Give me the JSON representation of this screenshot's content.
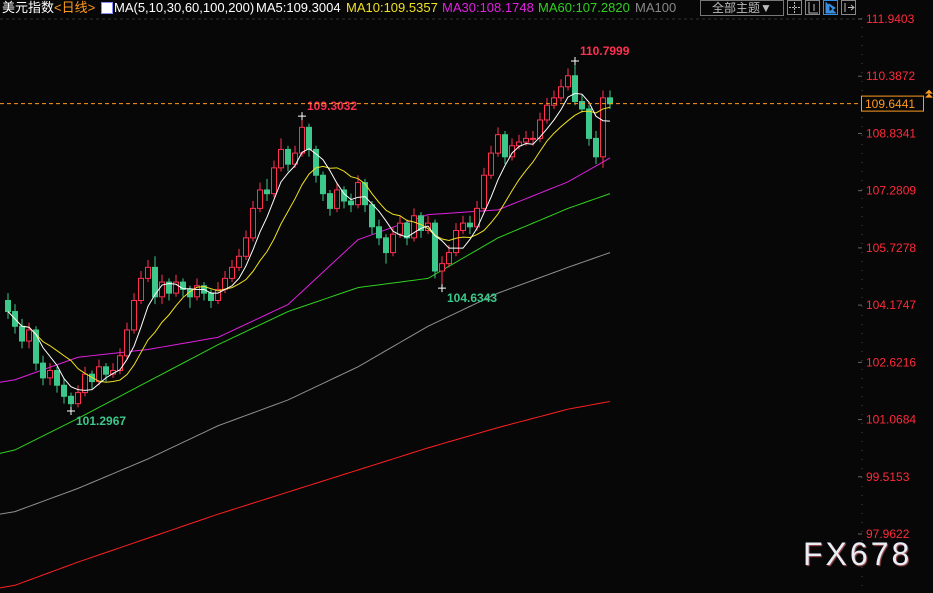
{
  "header": {
    "title": "美元指数",
    "period": "<日线>",
    "ma_spec": "MA(5,10,30,60,100,200)",
    "ma5": "MA5:109.3004",
    "ma10": "MA10:109.5357",
    "ma30": "MA30:108.1748",
    "ma60": "MA60:107.2820",
    "ma100": "MA100",
    "theme_button": "全部主题▼",
    "icons": [
      "crosshair-icon",
      "axis-icon",
      "play-icon",
      "exit-icon"
    ]
  },
  "watermark": "FX678",
  "colors": {
    "up": "#ff3050",
    "down": "#3cc88a",
    "ma5": "#ffffff",
    "ma10": "#f0e020",
    "ma30": "#e020e0",
    "ma60": "#30d020",
    "ma100": "#909090",
    "ma200": "#ff2020",
    "last": "#ff9a20"
  },
  "chart_data": {
    "type": "candlestick",
    "title": "美元指数 日线",
    "y_ticks": [
      "111.9403",
      "110.3872",
      "108.8341",
      "107.2809",
      "105.7278",
      "104.1747",
      "102.6216",
      "101.0684",
      "99.5153",
      "97.9622"
    ],
    "ylim": [
      97.9622,
      111.9403
    ],
    "last_price": "109.6441",
    "annotations": [
      {
        "text": "109.3032",
        "index": 42,
        "type": "high"
      },
      {
        "text": "110.7999",
        "index": 81,
        "type": "high"
      },
      {
        "text": "104.6343",
        "index": 62,
        "type": "low"
      },
      {
        "text": "101.2967",
        "index": 9,
        "type": "low"
      }
    ],
    "ohlc": [
      [
        104.3,
        104.5,
        103.8,
        104.0
      ],
      [
        104.0,
        104.2,
        103.4,
        103.6
      ],
      [
        103.6,
        103.8,
        103.0,
        103.2
      ],
      [
        103.2,
        103.7,
        103.0,
        103.5
      ],
      [
        103.5,
        103.6,
        102.4,
        102.6
      ],
      [
        102.6,
        102.8,
        102.0,
        102.2
      ],
      [
        102.2,
        102.6,
        102.0,
        102.4
      ],
      [
        102.4,
        102.5,
        101.8,
        102.0
      ],
      [
        102.0,
        102.2,
        101.5,
        101.7
      ],
      [
        101.7,
        101.8,
        101.3,
        101.5
      ],
      [
        101.5,
        102.0,
        101.4,
        101.8
      ],
      [
        101.8,
        102.5,
        101.7,
        102.3
      ],
      [
        102.3,
        102.4,
        101.9,
        102.1
      ],
      [
        102.1,
        102.7,
        102.0,
        102.5
      ],
      [
        102.5,
        102.6,
        102.1,
        102.3
      ],
      [
        102.3,
        102.6,
        102.2,
        102.4
      ],
      [
        102.4,
        103.0,
        102.3,
        102.8
      ],
      [
        102.8,
        103.7,
        102.7,
        103.5
      ],
      [
        103.5,
        104.5,
        103.4,
        104.3
      ],
      [
        104.3,
        105.1,
        104.2,
        104.9
      ],
      [
        104.9,
        105.4,
        104.8,
        105.2
      ],
      [
        105.2,
        105.5,
        104.2,
        104.4
      ],
      [
        104.4,
        105.0,
        104.2,
        104.8
      ],
      [
        104.8,
        104.9,
        104.3,
        104.5
      ],
      [
        104.5,
        105.0,
        104.4,
        104.8
      ],
      [
        104.8,
        104.9,
        104.4,
        104.6
      ],
      [
        104.6,
        104.7,
        104.1,
        104.4
      ],
      [
        104.4,
        104.9,
        104.3,
        104.7
      ],
      [
        104.7,
        104.8,
        104.3,
        104.5
      ],
      [
        104.5,
        104.6,
        104.1,
        104.3
      ],
      [
        104.3,
        104.8,
        104.2,
        104.6
      ],
      [
        104.6,
        105.1,
        104.5,
        104.9
      ],
      [
        104.9,
        105.4,
        104.8,
        105.2
      ],
      [
        105.2,
        105.7,
        105.1,
        105.5
      ],
      [
        105.5,
        106.2,
        105.4,
        106.0
      ],
      [
        106.0,
        107.0,
        105.9,
        106.8
      ],
      [
        106.8,
        107.5,
        106.7,
        107.3
      ],
      [
        107.3,
        107.6,
        107.0,
        107.2
      ],
      [
        107.2,
        108.1,
        107.1,
        107.9
      ],
      [
        107.9,
        108.7,
        107.8,
        108.4
      ],
      [
        108.4,
        108.5,
        107.8,
        108.0
      ],
      [
        108.0,
        108.5,
        107.9,
        108.3
      ],
      [
        108.3,
        109.3032,
        108.2,
        109.0
      ],
      [
        109.0,
        109.1,
        108.2,
        108.4
      ],
      [
        108.4,
        108.5,
        107.5,
        107.7
      ],
      [
        107.7,
        107.8,
        107.0,
        107.2
      ],
      [
        107.2,
        107.3,
        106.6,
        106.8
      ],
      [
        106.8,
        107.5,
        106.7,
        107.3
      ],
      [
        107.3,
        107.4,
        106.8,
        107.0
      ],
      [
        107.0,
        107.2,
        106.7,
        106.9
      ],
      [
        106.9,
        107.7,
        106.8,
        107.5
      ],
      [
        107.5,
        107.6,
        106.7,
        106.9
      ],
      [
        106.9,
        107.0,
        106.1,
        106.3
      ],
      [
        106.3,
        106.5,
        105.8,
        106.0
      ],
      [
        106.0,
        106.1,
        105.3,
        105.6
      ],
      [
        105.6,
        106.3,
        105.5,
        106.1
      ],
      [
        106.1,
        106.6,
        106.0,
        106.4
      ],
      [
        106.4,
        106.5,
        105.8,
        106.0
      ],
      [
        106.0,
        106.8,
        105.9,
        106.6
      ],
      [
        106.6,
        106.7,
        106.0,
        106.2
      ],
      [
        106.2,
        106.6,
        106.1,
        106.4
      ],
      [
        106.4,
        106.5,
        104.9,
        105.1
      ],
      [
        105.1,
        105.5,
        104.6343,
        105.3
      ],
      [
        105.3,
        105.8,
        105.2,
        105.6
      ],
      [
        105.6,
        106.4,
        105.5,
        106.2
      ],
      [
        106.2,
        106.6,
        106.1,
        106.4
      ],
      [
        106.4,
        106.6,
        106.1,
        106.3
      ],
      [
        106.3,
        107.0,
        106.2,
        106.8
      ],
      [
        106.8,
        107.9,
        106.7,
        107.7
      ],
      [
        107.7,
        108.5,
        107.6,
        108.3
      ],
      [
        108.3,
        109.0,
        108.2,
        108.8
      ],
      [
        108.8,
        108.9,
        108.0,
        108.2
      ],
      [
        108.2,
        108.7,
        108.1,
        108.5
      ],
      [
        108.5,
        108.8,
        108.4,
        108.6
      ],
      [
        108.6,
        108.9,
        108.5,
        108.7
      ],
      [
        108.7,
        108.9,
        108.5,
        108.7
      ],
      [
        108.7,
        109.4,
        108.6,
        109.2
      ],
      [
        109.2,
        109.8,
        109.1,
        109.6
      ],
      [
        109.6,
        110.0,
        109.5,
        109.8
      ],
      [
        109.8,
        110.3,
        109.7,
        110.1
      ],
      [
        110.1,
        110.6,
        110.0,
        110.4
      ],
      [
        110.4,
        110.7999,
        109.6,
        109.7
      ],
      [
        109.7,
        109.9,
        109.4,
        109.5
      ],
      [
        109.5,
        109.6,
        108.5,
        108.7
      ],
      [
        108.7,
        108.9,
        108.0,
        108.2
      ],
      [
        108.2,
        110.0,
        107.9,
        109.8
      ],
      [
        109.8,
        110.0,
        109.5,
        109.64
      ]
    ],
    "ma_samples_index": [
      0,
      10,
      20,
      30,
      40,
      50,
      60,
      70,
      80,
      86
    ],
    "ma30": [
      102.08,
      102.76,
      102.97,
      103.3,
      104.19,
      105.95,
      106.63,
      106.76,
      107.52,
      108.17
    ],
    "ma60": [
      100.15,
      101.1,
      102.1,
      103.1,
      104.0,
      104.65,
      104.9,
      106.0,
      106.8,
      107.2
    ],
    "ma100": [
      98.5,
      99.2,
      100.0,
      100.9,
      101.6,
      102.5,
      103.6,
      104.5,
      105.2,
      105.6
    ],
    "ma200": [
      96.5,
      97.2,
      97.85,
      98.5,
      99.1,
      99.7,
      100.3,
      100.85,
      101.35,
      101.56
    ]
  }
}
